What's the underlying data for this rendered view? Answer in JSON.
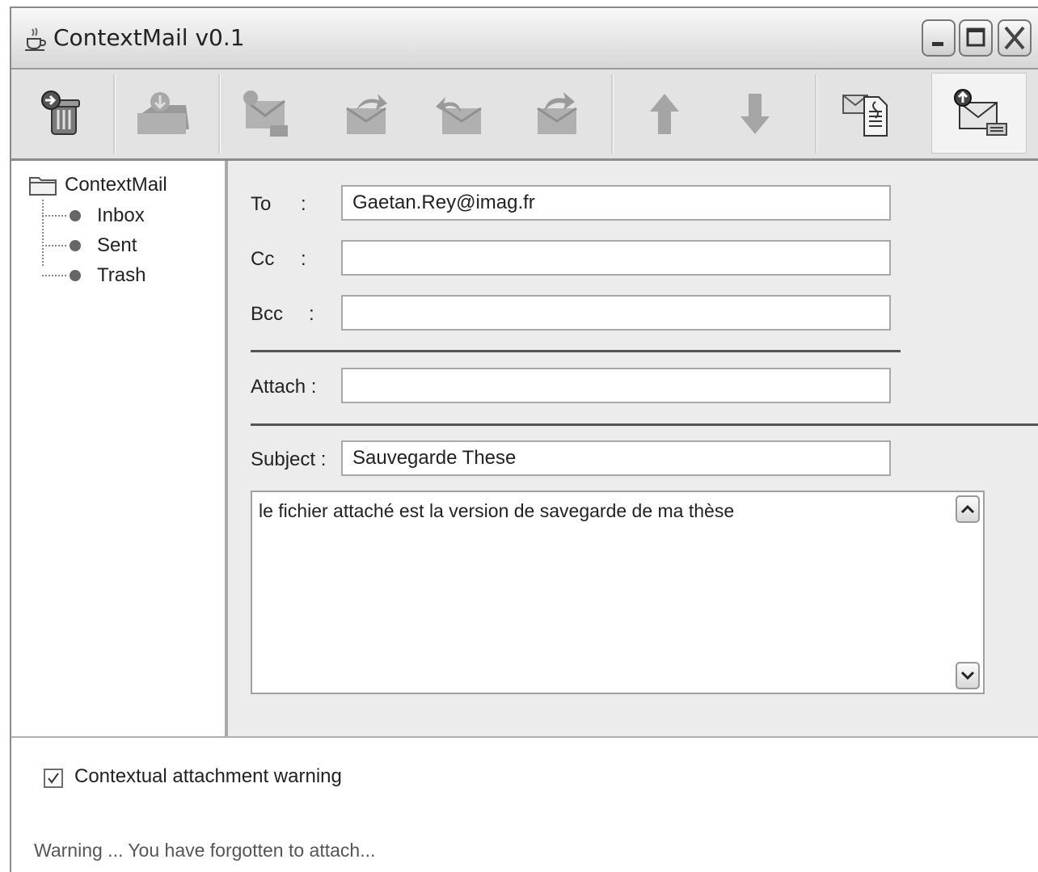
{
  "window": {
    "title": "ContextMail v0.1"
  },
  "toolbar": {
    "buttons": [
      {
        "icon": "trash-go-icon",
        "enabled": true
      },
      {
        "icon": "receive-mail-icon",
        "enabled": false
      },
      {
        "icon": "new-mail-icon",
        "enabled": false
      },
      {
        "icon": "reply-icon",
        "enabled": false
      },
      {
        "icon": "reply-all-icon",
        "enabled": false
      },
      {
        "icon": "forward-icon",
        "enabled": false
      },
      {
        "icon": "arrow-up-icon",
        "enabled": false
      },
      {
        "icon": "arrow-down-icon",
        "enabled": false
      },
      {
        "icon": "attach-document-icon",
        "enabled": true
      },
      {
        "icon": "send-mail-icon",
        "enabled": true,
        "active": true
      }
    ]
  },
  "tree": {
    "root": "ContextMail",
    "items": [
      "Inbox",
      "Sent",
      "Trash"
    ]
  },
  "compose": {
    "to_label": "To",
    "cc_label": "Cc",
    "bcc_label": "Bcc",
    "colon": ":",
    "attach_label": "Attach :",
    "subject_label": "Subject :",
    "to_value": "Gaetan.Rey@imag.fr",
    "cc_value": "",
    "bcc_value": "",
    "attach_value": "",
    "subject_value": "Sauvegarde These",
    "body": "le fichier attaché est la version de savegarde de ma thèse"
  },
  "bottom": {
    "checkbox_label": "Contextual attachment warning",
    "checkbox_checked": true,
    "warning_text": "Warning ... You have forgotten to attach..."
  }
}
